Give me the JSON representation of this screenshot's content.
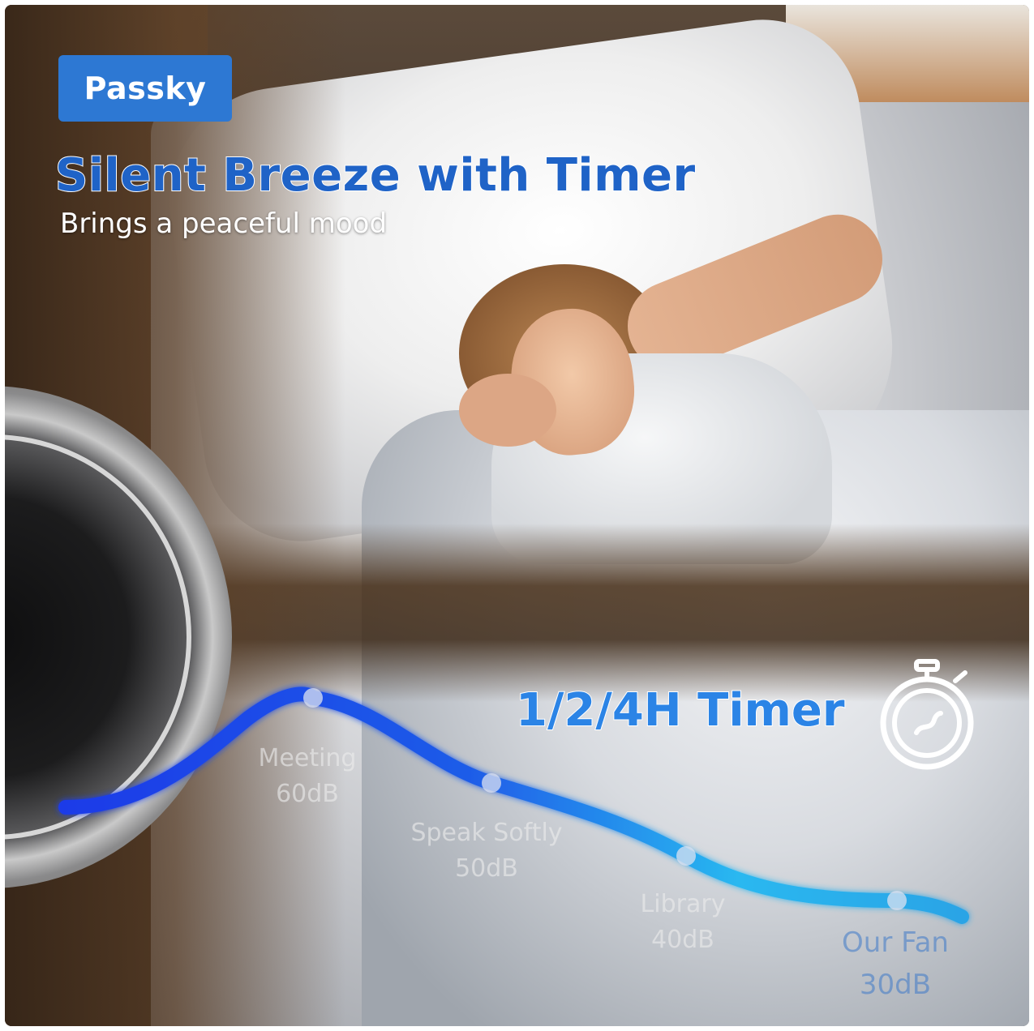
{
  "brand": {
    "name": "Passky",
    "color": "#2d78d3"
  },
  "headline": "Silent Breeze with Timer",
  "subheadline": "Brings a peaceful mood",
  "timer": {
    "label": "1/2/4H Timer",
    "icon": "stopwatch-icon"
  },
  "noise_levels": [
    {
      "name": "Meeting",
      "db": "60dB"
    },
    {
      "name": "Speak Softly",
      "db": "50dB"
    },
    {
      "name": "Library",
      "db": "40dB"
    },
    {
      "name": "Our Fan",
      "db": "30dB"
    }
  ],
  "colors": {
    "accent": "#2b84e6",
    "curve_start": "#1a3be8",
    "curve_end": "#29b8f0"
  }
}
